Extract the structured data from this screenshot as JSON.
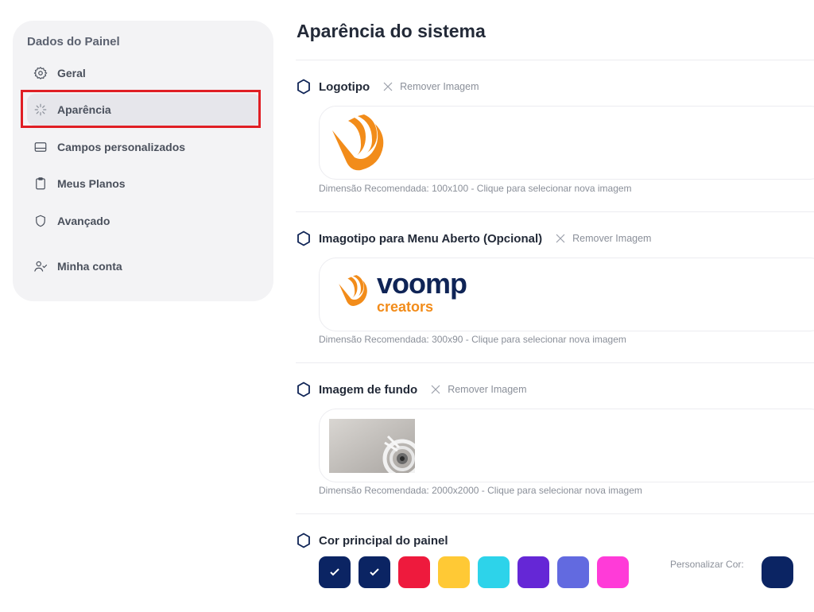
{
  "sidebar": {
    "title": "Dados do Painel",
    "items": [
      {
        "label": "Geral"
      },
      {
        "label": "Aparência"
      },
      {
        "label": "Campos personalizados"
      },
      {
        "label": "Meus Planos"
      },
      {
        "label": "Avançado"
      },
      {
        "label": "Minha conta"
      }
    ]
  },
  "main": {
    "title": "Aparência do sistema",
    "remove_label": "Remover Imagem",
    "sections": [
      {
        "title": "Logotipo",
        "hint": "Dimensão Recomendada: 100x100 - Clique para selecionar nova imagem"
      },
      {
        "title": "Imagotipo para Menu Aberto (Opcional)",
        "hint": "Dimensão Recomendada: 300x90 - Clique para selecionar nova imagem"
      },
      {
        "title": "Imagem de fundo",
        "hint": "Dimensão Recomendada: 2000x2000 - Clique para selecionar nova imagem"
      },
      {
        "title": "Cor principal do painel"
      }
    ],
    "brand": {
      "wordmark": "voomp",
      "subtitle": "creators"
    },
    "custom_color_label": "Personalizar Cor:"
  },
  "colors": {
    "brand_orange": "#f28c1a",
    "brand_navy": "#0f2456",
    "swatches": [
      "#0b2463",
      "#0b2463",
      "#ee1a3d",
      "#ffc935",
      "#2dd3ea",
      "#6527d6",
      "#626ae0",
      "#ff3bd8"
    ],
    "custom_color": "#0b2463"
  }
}
